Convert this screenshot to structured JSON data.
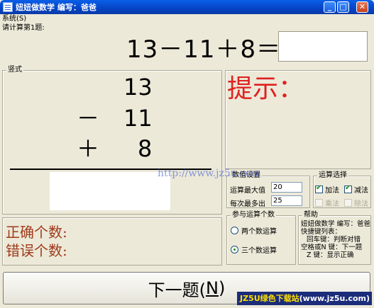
{
  "window": {
    "title": "妞妞做数学 编写：爸爸",
    "min": "_",
    "max": "□",
    "close": "✕"
  },
  "menu": {
    "system": "系统(S)"
  },
  "prompt_label": "请计算第1题:",
  "equation": "13－11＋8＝",
  "answer_value": "",
  "vertical": {
    "title": "竖式",
    "line1": "13",
    "op2": "－",
    "line2": "11",
    "op3": "＋",
    "line3": "8"
  },
  "hint": {
    "title": "提示："
  },
  "score": {
    "correct_label": "正确个数:",
    "wrong_label": "错误个数:"
  },
  "settings": {
    "title": "数值设置",
    "max_label": "运算最大值",
    "max_value": "20",
    "exceed_label": "每次最多出",
    "exceed_value": "25"
  },
  "ops": {
    "title": "运算选择",
    "add": "加法",
    "sub": "减法",
    "mul": "乘法",
    "div": "除法",
    "add_checked": true,
    "sub_checked": true,
    "mul_checked": false,
    "div_checked": false
  },
  "count": {
    "title": "参与运算个数",
    "two": "两个数运算",
    "three": "三个数运算",
    "selected": "three"
  },
  "help": {
    "title": "帮助",
    "rows": [
      "妞妞做数学 编写：爸爸",
      "快捷键列表：",
      "回车键：判断对错",
      "空格或N 键：下一题",
      "Z    键：显示正确"
    ]
  },
  "next_button": {
    "label": "下一题(",
    "key": "N",
    "close": ")"
  },
  "watermark": "http://www.jz5u.com",
  "badge": {
    "prefix": "JZ5U绿色下载站",
    "url": "(www.jz5u.com)"
  }
}
